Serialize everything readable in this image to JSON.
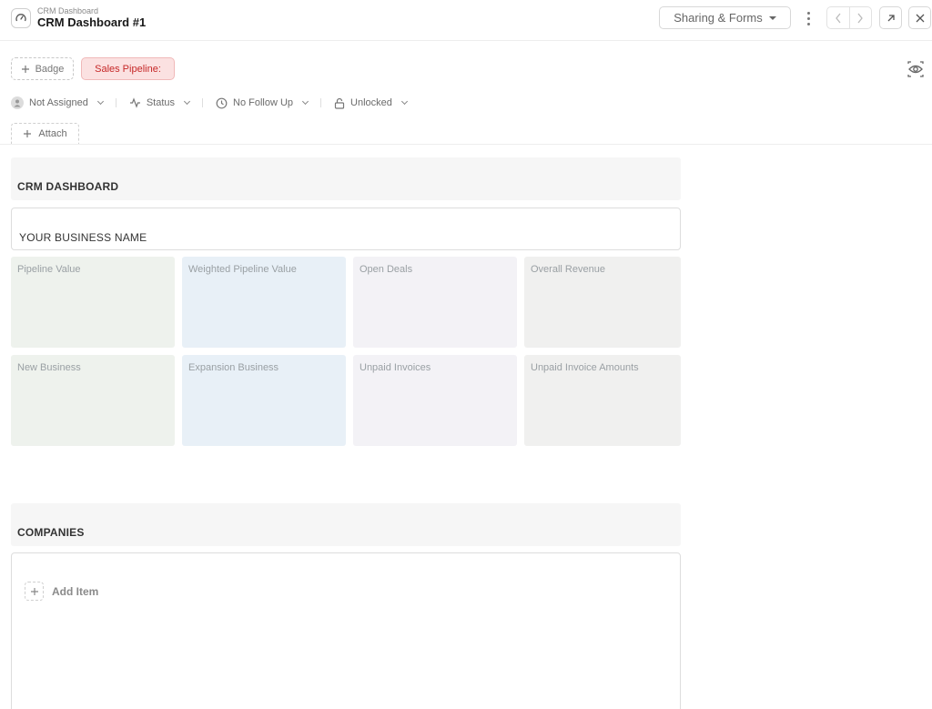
{
  "header": {
    "breadcrumb": "CRM Dashboard",
    "title": "CRM Dashboard #1",
    "sharing_label": "Sharing & Forms",
    "app_icon": "gauge-icon"
  },
  "badges": {
    "add_label": "Badge",
    "sales_label": "Sales Pipeline:",
    "sales_color": "#c62828"
  },
  "meta": {
    "assignee": "Not Assigned",
    "status": "Status",
    "follow_up": "No Follow Up",
    "lock": "Unlocked"
  },
  "attach_label": "Attach",
  "dashboard": {
    "section_title": "CRM DASHBOARD",
    "business_name": "YOUR BUSINESS NAME",
    "cards": [
      {
        "label": "Pipeline Value"
      },
      {
        "label": "Weighted Pipeline Value"
      },
      {
        "label": "Open Deals"
      },
      {
        "label": "Overall Revenue"
      },
      {
        "label": "New Business"
      },
      {
        "label": "Expansion Business"
      },
      {
        "label": "Unpaid Invoices"
      },
      {
        "label": "Unpaid Invoice Amounts"
      }
    ]
  },
  "companies": {
    "section_title": "COMPANIES",
    "add_item_label": "Add Item"
  }
}
